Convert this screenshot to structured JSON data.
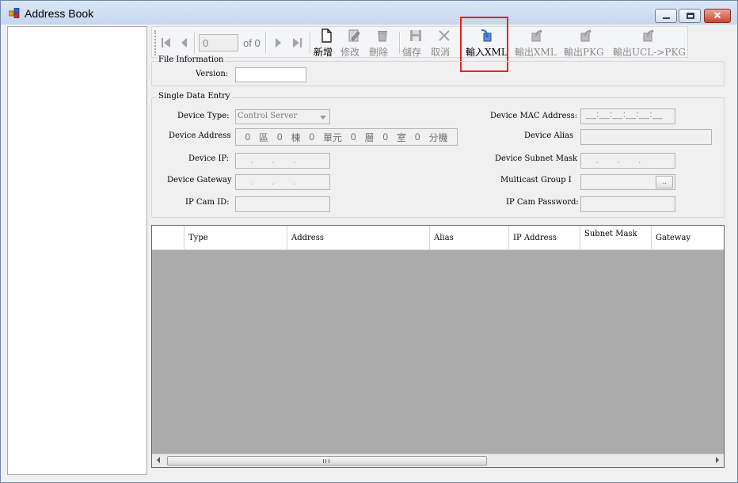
{
  "window": {
    "title": "Address Book"
  },
  "toolbar": {
    "page_value": "0",
    "page_of": "of 0",
    "buttons": {
      "new": "新增",
      "edit": "修改",
      "delete": "刪除",
      "save": "儲存",
      "cancel": "取消",
      "import_xml": "輸入XML",
      "export_xml": "輸出XML",
      "export_pkg": "輸出PKG",
      "export_ucl_pkg": "輸出UCL->PKG"
    }
  },
  "file_info": {
    "title": "File Information",
    "version_label": "Version:",
    "version_value": ""
  },
  "single_entry": {
    "title": "Single Data Entry",
    "device_type_label": "Device Type:",
    "device_type_value": "Control Server",
    "device_address_label": "Device Address",
    "address_parts": [
      "0",
      "區",
      "0",
      "棟",
      "0",
      "單元",
      "0",
      "層",
      "0",
      "室",
      "0",
      "分機"
    ],
    "device_ip_label": "Device IP:",
    "device_gateway_label": "Device Gateway",
    "ip_cam_id_label": "IP Cam ID:",
    "device_mac_label": "Device MAC Address:",
    "mac_mask": "__:__:__:__:__:__",
    "device_alias_label": "Device Alias",
    "device_subnet_label": "Device Subnet Mask",
    "multicast_label": "Multicast Group I",
    "multicast_button": "..",
    "ip_cam_password_label": "IP Cam Password:"
  },
  "grid": {
    "columns": [
      "Type",
      "Address",
      "Alias",
      "IP Address",
      "Subnet Mask",
      "Gateway"
    ],
    "scroll_grip": "III"
  }
}
